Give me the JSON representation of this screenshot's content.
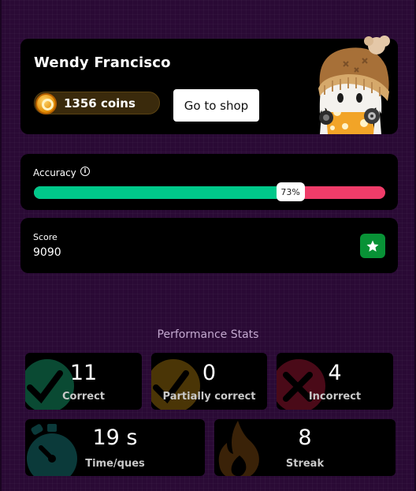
{
  "profile": {
    "name": "Wendy Francisco",
    "coins_label": "1356 coins",
    "shop_button": "Go to shop"
  },
  "accuracy": {
    "label": "Accuracy",
    "percent_label": "73%",
    "value": 0.73,
    "colors": {
      "correct": "#00c88a",
      "incorrect": "#ef3c69"
    }
  },
  "score": {
    "label": "Score",
    "value": "9090"
  },
  "stats": {
    "title": "Performance Stats",
    "items": [
      {
        "value": "11",
        "label": "Correct",
        "icon": "check-icon",
        "color": "#0a4a33"
      },
      {
        "value": "0",
        "label": "Partially correct",
        "icon": "check-icon",
        "color": "#4a3506"
      },
      {
        "value": "4",
        "label": "Incorrect",
        "icon": "cross-icon",
        "color": "#4a0a18"
      },
      {
        "value": "19 s",
        "label": "Time/ques",
        "icon": "stopwatch-icon",
        "color": "#0b3a3a"
      },
      {
        "value": "8",
        "label": "Streak",
        "icon": "flame-icon",
        "color": "#3a2208"
      }
    ]
  }
}
